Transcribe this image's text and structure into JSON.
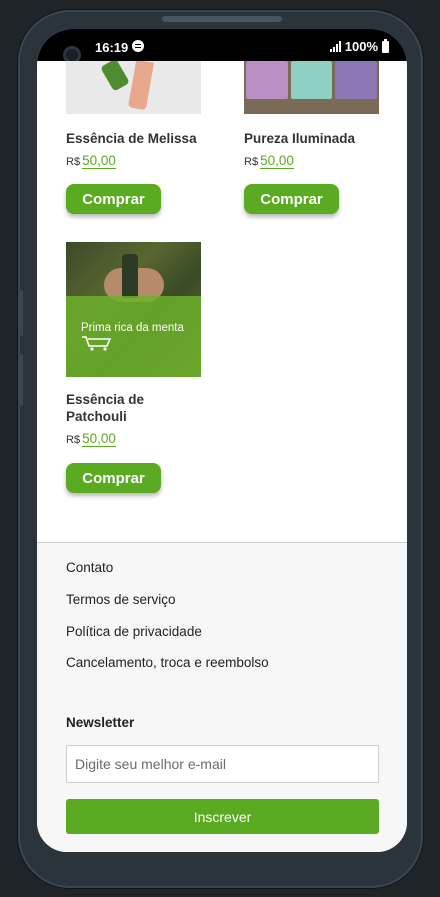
{
  "statusbar": {
    "time": "16:19",
    "battery": "100%"
  },
  "products": [
    {
      "name": "Essência de Melissa",
      "currency": "R$",
      "price": "50,00",
      "button": "Comprar"
    },
    {
      "name": "Pureza Iluminada",
      "currency": "R$",
      "price": "50,00",
      "button": "Comprar"
    },
    {
      "name": "Essência de Patchouli",
      "currency": "R$",
      "price": "50,00",
      "button": "Comprar",
      "hover_text": "Prima rica da menta"
    }
  ],
  "footer": {
    "links": [
      "Contato",
      "Termos de serviço",
      "Política de privacidade",
      "Cancelamento, troca e reembolso"
    ],
    "newsletter_title": "Newsletter",
    "email_placeholder": "Digite seu melhor e-mail",
    "subscribe_label": "Inscrever"
  },
  "colors": {
    "accent": "#5aaa22",
    "footer_bg": "#f7f7f7"
  }
}
